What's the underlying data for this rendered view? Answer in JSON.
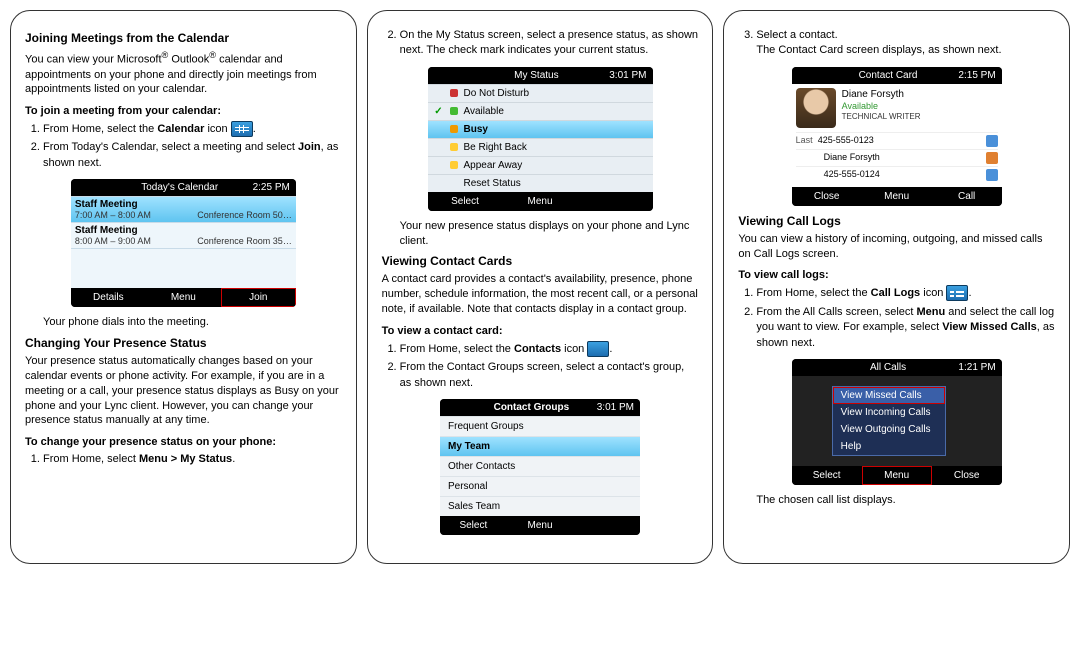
{
  "col1": {
    "h1": "Joining Meetings from the Calendar",
    "p1a": "You can view your Microsoft",
    "p1reg": "®",
    "p1b": " Outlook",
    "p1c": " calendar and appointments on your phone and directly join meetings from appointments listed on your calendar.",
    "sub1": "To join a meeting from your calendar:",
    "s1a": "From Home, select the ",
    "s1b": "Calendar",
    "s1c": " icon ",
    "s2a": "From Today's Calendar, select a meeting and select ",
    "s2b": "Join",
    "s2c": ", as shown next.",
    "cal": {
      "title": "Today's Calendar",
      "time": "2:25 PM",
      "r1t": "Staff Meeting",
      "r1s": "7:00 AM – 8:00 AM",
      "r1loc": "Conference Room 50…",
      "r2t": "Staff Meeting",
      "r2s": "8:00 AM – 9:00 AM",
      "r2loc": "Conference Room 35…",
      "k1": "Details",
      "k2": "Menu",
      "k3": "Join"
    },
    "after1": "Your phone dials into the meeting.",
    "h2": "Changing Your Presence Status",
    "p2": "Your presence status automatically changes based on your calendar events or phone activity. For example, if you are in a meeting or a call, your presence status displays as Busy on your phone and your Lync client. However, you can change your presence status manually at any time.",
    "sub2": "To change your presence status on your phone:",
    "s3a": "From Home, select ",
    "s3b": "Menu > My Status",
    "s3c": "."
  },
  "col2": {
    "s4a": "On the My Status screen, select a presence status, as shown next. The check mark indicates your current status.",
    "st": {
      "title": "My Status",
      "time": "3:01 PM",
      "r1": "Do Not Disturb",
      "r2": "Available",
      "r3": "Busy",
      "r4": "Be Right Back",
      "r5": "Appear Away",
      "r6": "Reset Status",
      "k1": "Select",
      "k2": "Menu"
    },
    "after2": "Your new presence status displays on your phone and Lync client.",
    "h3": "Viewing Contact Cards",
    "p3": "A contact card provides a contact's availability, presence, phone number, schedule information, the most recent call, or a personal note, if available. Note that contacts display in a contact group.",
    "sub3": "To view a contact card:",
    "s5a": "From Home, select the ",
    "s5b": "Contacts",
    "s5c": " icon ",
    "s6": "From the Contact Groups screen, select a contact's group, as shown next.",
    "cg": {
      "title": "Contact Groups",
      "time": "3:01 PM",
      "r1": "Frequent Groups",
      "r2": "My Team",
      "r3": "Other Contacts",
      "r4": "Personal",
      "r5": "Sales Team",
      "k1": "Select",
      "k2": "Menu"
    }
  },
  "col3": {
    "s7a": "Select a contact.",
    "s7b": "The Contact Card screen displays, as shown next.",
    "cc": {
      "title": "Contact Card",
      "time": "2:15 PM",
      "name": "Diane Forsyth",
      "pres": "Available",
      "role": "TECHNICAL WRITER",
      "lab1": "Last",
      "v1": "425-555-0123",
      "lab2": "",
      "v2": "Diane Forsyth",
      "lab3": "",
      "v3": "425-555-0124",
      "k1": "Close",
      "k2": "Menu",
      "k3": "Call"
    },
    "h4": "Viewing Call Logs",
    "p4": "You can view a history of incoming, outgoing, and missed calls on Call Logs screen.",
    "sub4": "To view call logs:",
    "s8a": "From Home, select the ",
    "s8b": "Call Logs",
    "s8c": " icon ",
    "s9a": "From the All Calls screen, select ",
    "s9b": "Menu",
    "s9c": " and select the call log you want to view. For example, select ",
    "s9d": "View Missed Calls",
    "s9e": ", as shown next.",
    "ac": {
      "title": "All Calls",
      "time": "1:21 PM",
      "m1": "View Missed Calls",
      "m2": "View Incoming Calls",
      "m3": "View Outgoing Calls",
      "m4": "Help",
      "k1": "Select",
      "k2": "Menu",
      "k3": "Close"
    },
    "after3": "The chosen call list displays."
  }
}
